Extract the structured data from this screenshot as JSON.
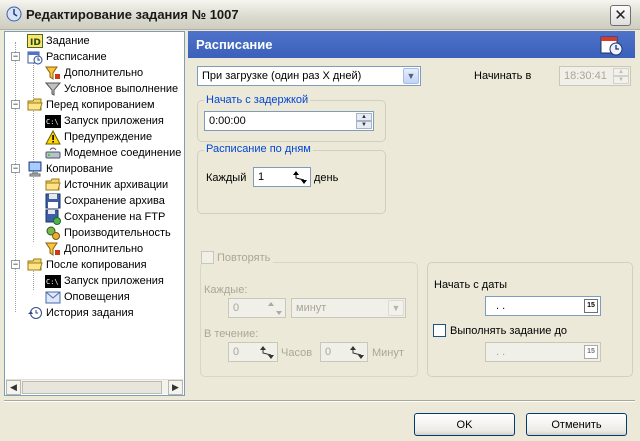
{
  "window": {
    "title": "Редактирование задания № 1007",
    "close_label": "✕"
  },
  "tree": {
    "items": [
      {
        "label": "Задание",
        "icon": "id-card-icon"
      },
      {
        "label": "Расписание",
        "icon": "clock-calendar-icon"
      },
      {
        "label": "Дополнительно",
        "icon": "filter-icon"
      },
      {
        "label": "Условное выполнение",
        "icon": "funnel-icon"
      },
      {
        "label": "Перед копированием",
        "icon": "folder-icon"
      },
      {
        "label": "Запуск приложения",
        "icon": "console-icon"
      },
      {
        "label": "Предупреждение",
        "icon": "warning-icon"
      },
      {
        "label": "Модемное соединение",
        "icon": "modem-icon"
      },
      {
        "label": "Копирование",
        "icon": "computer-icon"
      },
      {
        "label": "Источник архивации",
        "icon": "folder-icon"
      },
      {
        "label": "Сохранение архива",
        "icon": "floppy-icon"
      },
      {
        "label": "Сохранение на FTP",
        "icon": "floppy-net-icon"
      },
      {
        "label": "Производительность",
        "icon": "gears-icon"
      },
      {
        "label": "Дополнительно",
        "icon": "filter-icon"
      },
      {
        "label": "После копирования",
        "icon": "folder-icon"
      },
      {
        "label": "Запуск приложения",
        "icon": "console-icon"
      },
      {
        "label": "Оповещения",
        "icon": "envelope-icon"
      },
      {
        "label": "История задания",
        "icon": "history-icon"
      }
    ]
  },
  "panel": {
    "title": "Расписание",
    "schedule_type": "При загрузке (один раз Х дней)",
    "start_at_label": "Начинать в",
    "start_at_value": "18:30:41",
    "delay_group_label": "Начать с задержкой",
    "delay_value": "0:00:00",
    "days_group_label": "Расписание по дням",
    "every_label": "Каждый",
    "every_value": "1",
    "day_unit": "день",
    "repeat_label": "Повторять",
    "each_label": "Каждые:",
    "each_value": "0",
    "each_unit": "минут",
    "during_label": "В течение:",
    "hours_value": "0",
    "hours_label": "Часов",
    "minutes_value": "0",
    "minutes_label": "Минут",
    "start_date_label": "Начать с даты",
    "start_date_value": ". .",
    "run_until_label": "Выполнять задание до",
    "run_until_value": ". .",
    "cal_label": "15"
  },
  "footer": {
    "ok_label": "OK",
    "cancel_label": "Отменить"
  }
}
